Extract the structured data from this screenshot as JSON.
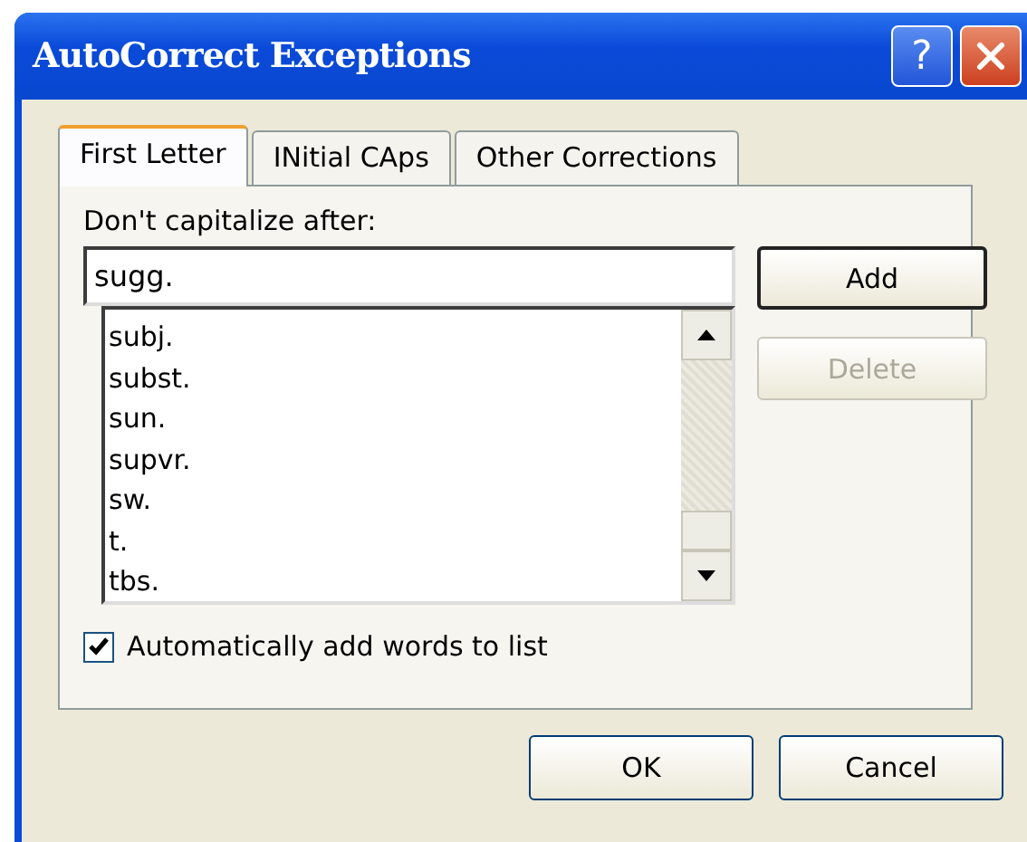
{
  "window": {
    "title": "AutoCorrect Exceptions",
    "help_button": "?"
  },
  "tabs": [
    {
      "label": "First Letter",
      "selected": true
    },
    {
      "label": "INitial CAps",
      "selected": false
    },
    {
      "label": "Other Corrections",
      "selected": false
    }
  ],
  "field_label": "Don't capitalize after:",
  "field": {
    "value": "sugg."
  },
  "list_items": [
    "subj.",
    "subst.",
    "sun.",
    "supvr.",
    "sw.",
    "t.",
    "tbs."
  ],
  "side_buttons": [
    {
      "label": "Add",
      "disabled": false,
      "default": true
    },
    {
      "label": "Delete",
      "disabled": true,
      "default": false
    }
  ],
  "checkbox": {
    "label": "Automatically add words to list",
    "checked": true
  },
  "buttons": [
    "OK",
    "Cancel"
  ]
}
